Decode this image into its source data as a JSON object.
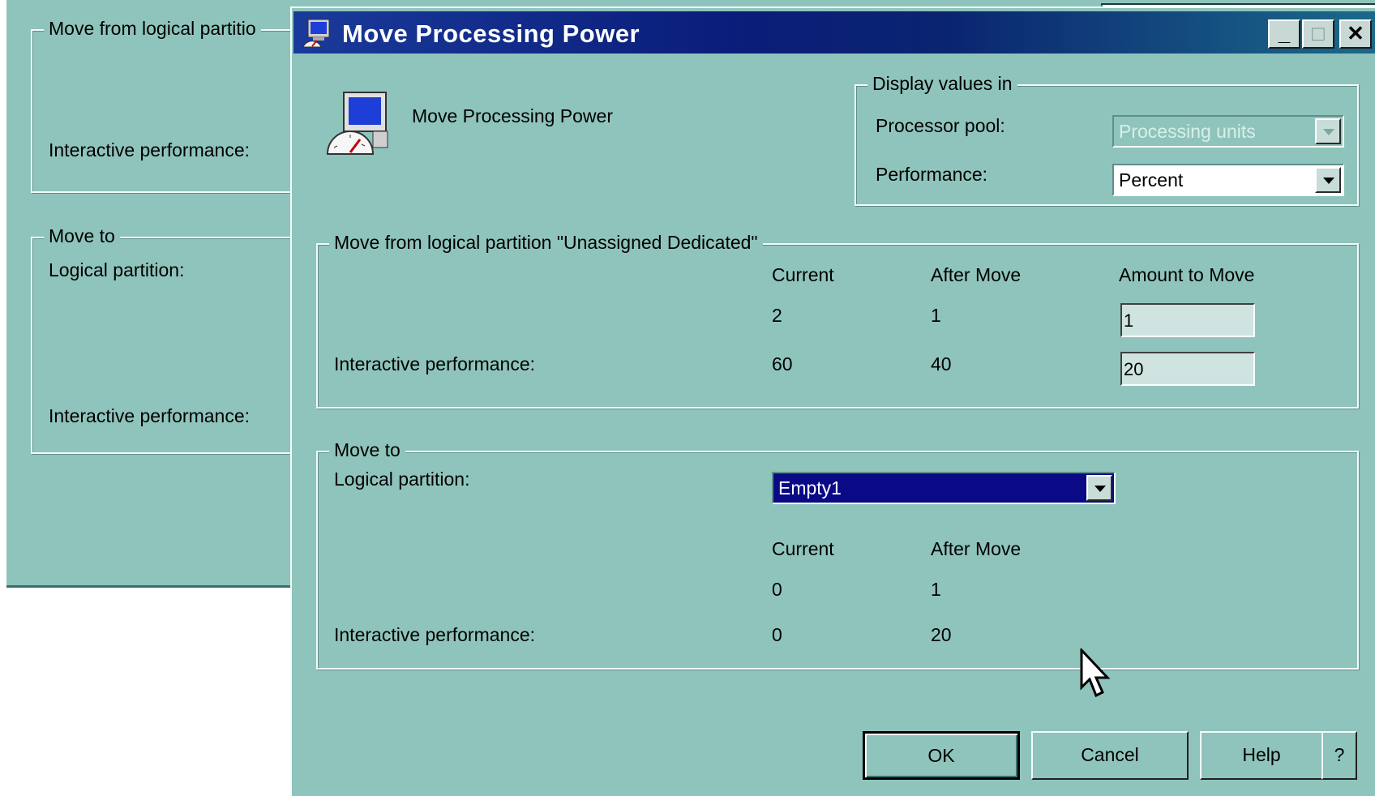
{
  "background_window": {
    "move_from_label": "Move from logical partitio",
    "interactive_performance_label": "Interactive performance:",
    "move_to_label": "Move to",
    "logical_partition_label": "Logical partition:",
    "interactive_performance_label_2": "Interactive performance:"
  },
  "dialog": {
    "title": "Move Processing Power",
    "header_label": "Move Processing Power",
    "titlebar_buttons": {
      "minimize": "_",
      "maximize": "□",
      "close": "✕"
    }
  },
  "display_values": {
    "legend": "Display values in",
    "processor_pool_label": "Processor pool:",
    "processor_pool_value": "Processing units",
    "performance_label": "Performance:",
    "performance_value": "Percent"
  },
  "move_from": {
    "legend": "Move from logical partition \"Unassigned Dedicated\"",
    "col_current": "Current",
    "col_after": "After Move",
    "col_amount": "Amount to Move",
    "row1": {
      "current": "2",
      "after": "1",
      "amount": "1"
    },
    "row2": {
      "label": "Interactive performance:",
      "current": "60",
      "after": "40",
      "amount": "20"
    }
  },
  "move_to": {
    "legend": "Move to",
    "logical_partition_label": "Logical partition:",
    "logical_partition_value": "Empty1",
    "col_current": "Current",
    "col_after": "After Move",
    "row1": {
      "current": "0",
      "after": "1"
    },
    "row2": {
      "label": "Interactive performance:",
      "current": "0",
      "after": "20"
    }
  },
  "buttons": {
    "ok": "OK",
    "cancel": "Cancel",
    "help": "Help",
    "question": "?"
  },
  "colors": {
    "window_bg": "#8fc4bc",
    "titlebar": "#0a1d7a",
    "selection": "#0a0a86"
  }
}
